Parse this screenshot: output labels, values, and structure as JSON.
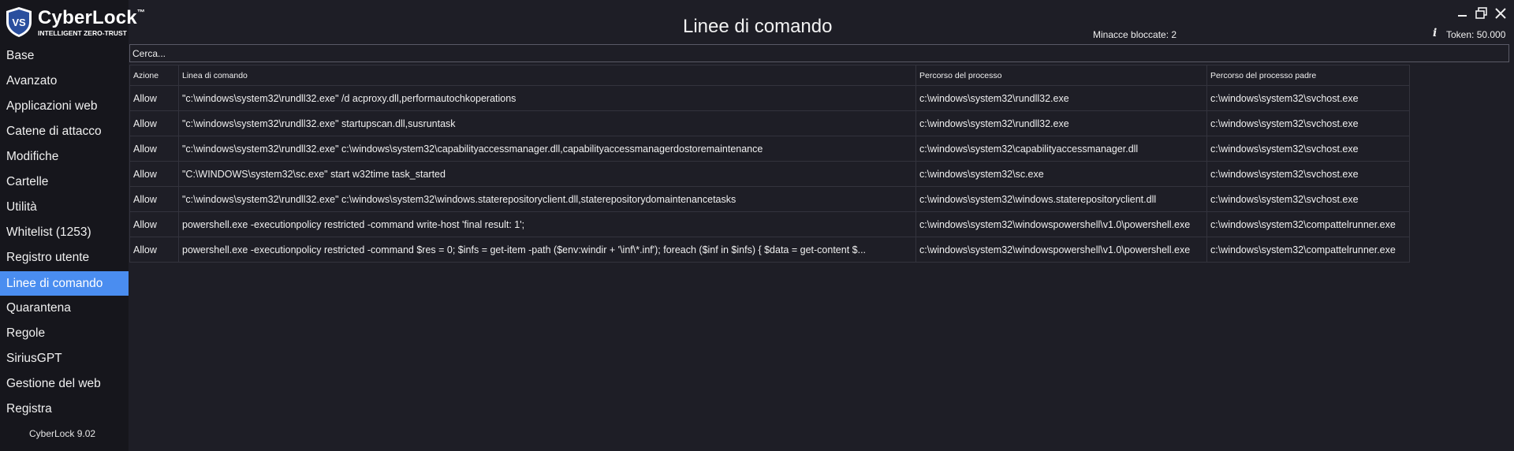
{
  "app": {
    "brand": "CyberLock",
    "brand_mark": "™",
    "tagline": "INTELLIGENT ZERO-TRUST",
    "logo_letters": "VS",
    "version": "CyberLock 9.02",
    "accent": "#4a8df0"
  },
  "header": {
    "title": "Linee di comando",
    "threats_blocked": "Minacce bloccate: 2",
    "tokens": "Token: 50.000",
    "info_icon": "info-icon"
  },
  "sidebar": {
    "items": [
      {
        "label": "Base"
      },
      {
        "label": "Avanzato"
      },
      {
        "label": "Applicazioni web"
      },
      {
        "label": "Catene di attacco"
      },
      {
        "label": "Modifiche"
      },
      {
        "label": "Cartelle"
      },
      {
        "label": "Utilità"
      },
      {
        "label": "Whitelist (1253)"
      },
      {
        "label": "Registro utente"
      },
      {
        "label": "Linee di comando",
        "active": true
      },
      {
        "label": "Quarantena"
      },
      {
        "label": "Regole"
      },
      {
        "label": "SiriusGPT"
      },
      {
        "label": "Gestione del web"
      },
      {
        "label": "Registra"
      }
    ]
  },
  "search": {
    "placeholder": "Cerca...",
    "value": ""
  },
  "table": {
    "columns": [
      "Azione",
      "Linea di comando",
      "Percorso del processo",
      "Percorso del processo padre"
    ],
    "rows": [
      [
        "Allow",
        "\"c:\\windows\\system32\\rundll32.exe\" /d acproxy.dll,performautochkoperations",
        "c:\\windows\\system32\\rundll32.exe",
        "c:\\windows\\system32\\svchost.exe"
      ],
      [
        "Allow",
        "\"c:\\windows\\system32\\rundll32.exe\" startupscan.dll,susruntask",
        "c:\\windows\\system32\\rundll32.exe",
        "c:\\windows\\system32\\svchost.exe"
      ],
      [
        "Allow",
        "\"c:\\windows\\system32\\rundll32.exe\" c:\\windows\\system32\\capabilityaccessmanager.dll,capabilityaccessmanagerdostoremaintenance",
        "c:\\windows\\system32\\capabilityaccessmanager.dll",
        "c:\\windows\\system32\\svchost.exe"
      ],
      [
        "Allow",
        "\"C:\\WINDOWS\\system32\\sc.exe\" start w32time task_started",
        "c:\\windows\\system32\\sc.exe",
        "c:\\windows\\system32\\svchost.exe"
      ],
      [
        "Allow",
        "\"c:\\windows\\system32\\rundll32.exe\" c:\\windows\\system32\\windows.staterepositoryclient.dll,staterepositorydomaintenancetasks",
        "c:\\windows\\system32\\windows.staterepositoryclient.dll",
        "c:\\windows\\system32\\svchost.exe"
      ],
      [
        "Allow",
        "powershell.exe -executionpolicy restricted -command write-host 'final result: 1';",
        "c:\\windows\\system32\\windowspowershell\\v1.0\\powershell.exe",
        "c:\\windows\\system32\\compattelrunner.exe"
      ],
      [
        "Allow",
        "powershell.exe -executionpolicy restricted -command  $res = 0; $infs = get-item -path ($env:windir + '\\inf\\*.inf'); foreach ($inf in $infs) { $data = get-content $...",
        "c:\\windows\\system32\\windowspowershell\\v1.0\\powershell.exe",
        "c:\\windows\\system32\\compattelrunner.exe"
      ]
    ]
  },
  "window_controls": {
    "minimize": "minimize-icon",
    "restore": "restore-icon",
    "close": "close-icon"
  }
}
